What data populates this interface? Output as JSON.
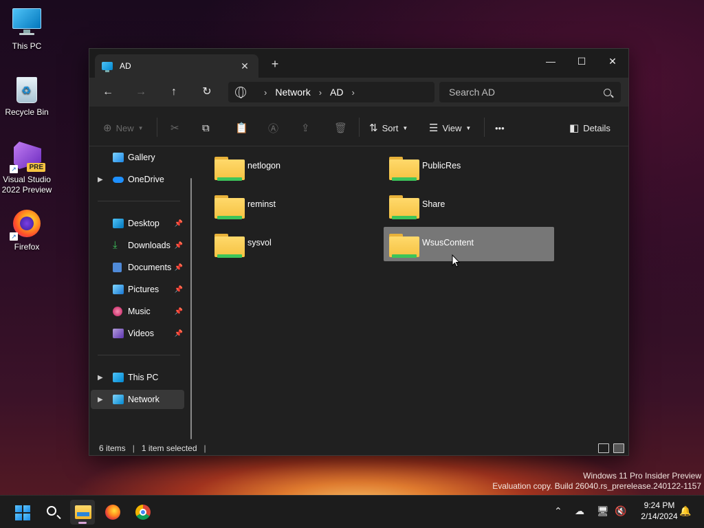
{
  "desktop": {
    "icons": [
      {
        "label": "This PC",
        "icon": "pc-icon"
      },
      {
        "label": "Recycle Bin",
        "icon": "recycle-bin-icon"
      },
      {
        "label": "Visual Studio 2022 Preview",
        "badge": "PRE",
        "icon": "visual-studio-icon"
      },
      {
        "label": "Firefox",
        "icon": "firefox-icon"
      }
    ]
  },
  "window": {
    "tab_title": "AD",
    "new_tab": "+",
    "controls": {
      "minimize": "—",
      "maximize": "☐",
      "close": "✕"
    },
    "address": {
      "segments": [
        "Network",
        "AD"
      ]
    },
    "search": {
      "placeholder": "Search AD"
    },
    "commands": {
      "new": "New",
      "sort": "Sort",
      "view": "View",
      "more": "•••",
      "details": "Details"
    },
    "sidebar": {
      "items": [
        {
          "label": "Gallery"
        },
        {
          "label": "OneDrive"
        },
        {
          "label": "Desktop"
        },
        {
          "label": "Downloads"
        },
        {
          "label": "Documents"
        },
        {
          "label": "Pictures"
        },
        {
          "label": "Music"
        },
        {
          "label": "Videos"
        },
        {
          "label": "This PC"
        },
        {
          "label": "Network"
        }
      ]
    },
    "folders": [
      {
        "name": "netlogon"
      },
      {
        "name": "PublicRes"
      },
      {
        "name": "reminst"
      },
      {
        "name": "Share"
      },
      {
        "name": "sysvol"
      },
      {
        "name": "WsusContent",
        "selected": true
      }
    ],
    "status": {
      "count": "6 items",
      "selection": "1 item selected"
    }
  },
  "watermark": {
    "line1": "Windows 11 Pro Insider Preview",
    "line2": "Evaluation copy. Build 26040.rs_prerelease.240122-1157"
  },
  "taskbar": {
    "time": "9:24 PM",
    "date": "2/14/2024"
  },
  "colors": {
    "window_bg": "#202020",
    "selected_item": "#777777",
    "folder_yellow": "#f5c242",
    "network_green": "#3cc45a"
  }
}
